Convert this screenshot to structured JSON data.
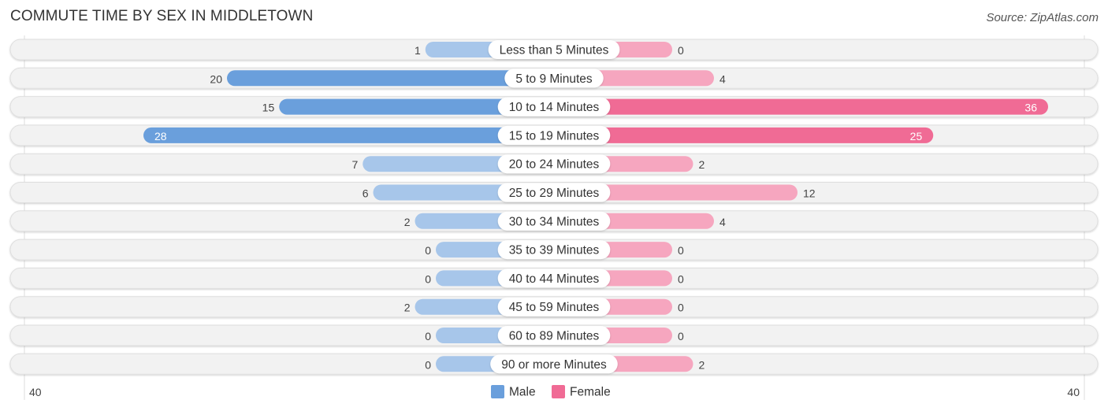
{
  "header": {
    "title": "COMMUTE TIME BY SEX IN MIDDLETOWN",
    "source": "Source: ZipAtlas.com"
  },
  "colors": {
    "male": "#6a9fdc",
    "male_light": "#a7c6ea",
    "female": "#f06b95",
    "female_light": "#f6a6bf",
    "row_bg": "#f2f2f2"
  },
  "chart_data": {
    "type": "bar",
    "orientation": "horizontal-diverging",
    "title": "COMMUTE TIME BY SEX IN MIDDLETOWN",
    "categories": [
      "Less than 5 Minutes",
      "5 to 9 Minutes",
      "10 to 14 Minutes",
      "15 to 19 Minutes",
      "20 to 24 Minutes",
      "25 to 29 Minutes",
      "30 to 34 Minutes",
      "35 to 39 Minutes",
      "40 to 44 Minutes",
      "45 to 59 Minutes",
      "60 to 89 Minutes",
      "90 or more Minutes"
    ],
    "series": [
      {
        "name": "Male",
        "values": [
          1,
          20,
          15,
          28,
          7,
          6,
          2,
          0,
          0,
          2,
          0,
          0
        ]
      },
      {
        "name": "Female",
        "values": [
          0,
          4,
          36,
          25,
          2,
          12,
          4,
          0,
          0,
          0,
          0,
          2
        ]
      }
    ],
    "axis": {
      "left_max_label": "40",
      "right_max_label": "40",
      "max": 40
    },
    "legend": {
      "position": "bottom-center",
      "items": [
        "Male",
        "Female"
      ]
    },
    "grid": false
  }
}
